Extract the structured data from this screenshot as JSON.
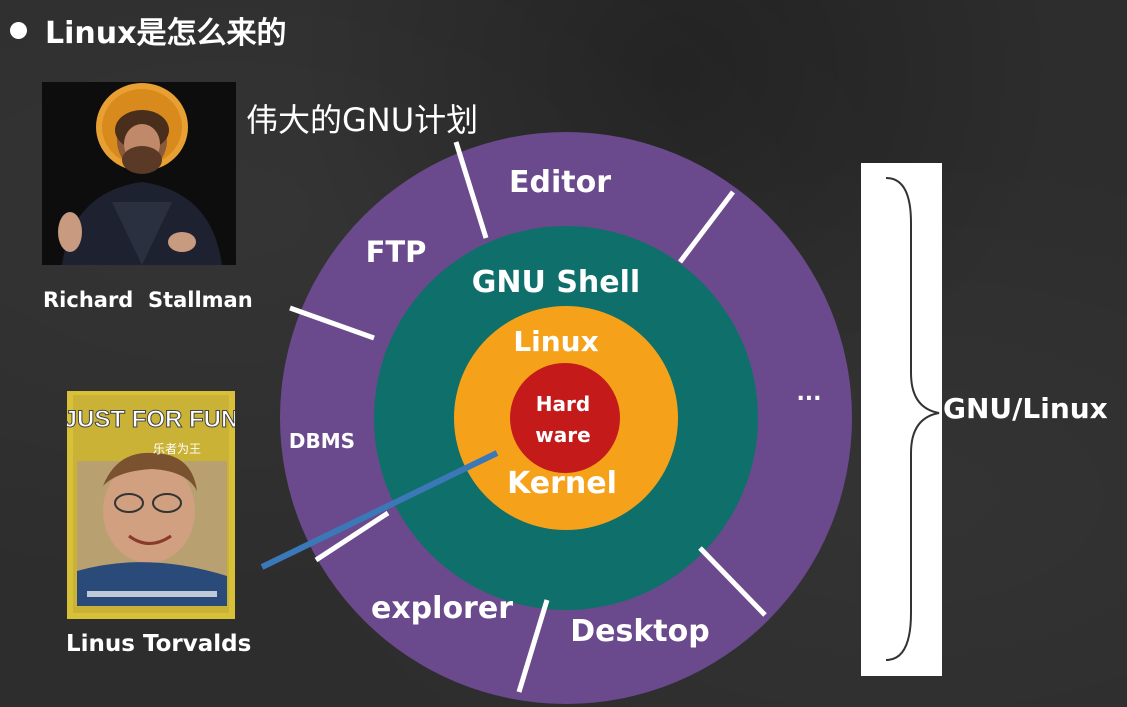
{
  "slide": {
    "title": "Linux是怎么来的",
    "gnu_plan": "伟大的GNU计划",
    "person1_caption": "Richard  Stallman",
    "person2_caption": "Linus Torvalds",
    "book_title": "JUST FOR FUN",
    "book_subtitle": "乐者为王",
    "gnu_linux_label": "GNU/Linux"
  },
  "diagram": {
    "outer_ring": [
      "Editor",
      "FTP",
      "DBMS",
      "explorer",
      "Desktop",
      "..."
    ],
    "middle_ring": "GNU Shell",
    "inner_ring": [
      "Linux",
      "Kernel"
    ],
    "core": [
      "Hard",
      "ware"
    ],
    "colors": {
      "outer": "#6a4a8c",
      "middle": "#0f6f6a",
      "inner": "#f5a21a",
      "core": "#c41a1a",
      "pointer": "#3a78b8"
    }
  }
}
